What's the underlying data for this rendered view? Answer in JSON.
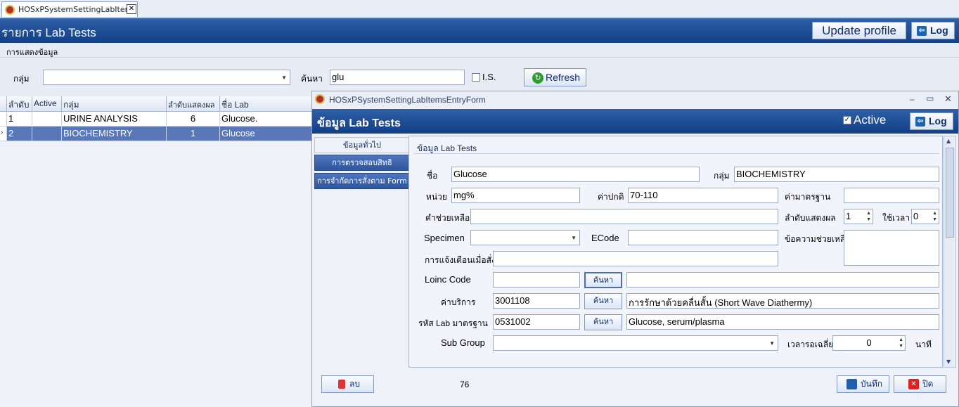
{
  "tab": {
    "title": "HOSxPSystemSettingLabItems",
    "close": "✕"
  },
  "header": {
    "title": "รายการ Lab Tests",
    "update_profile": "Update profile",
    "log": "Log"
  },
  "subbar": {
    "label": "การแสดงข้อมูล"
  },
  "filter": {
    "group_label": "กลุ่ม",
    "group_value": "",
    "search_label": "ค้นหา",
    "search_value": "glu",
    "is_label": "I.S.",
    "is_checked": false,
    "refresh": "Refresh"
  },
  "grid": {
    "columns": [
      "ลำดับ",
      "Active",
      "กลุ่ม",
      "ลำดับแสดงผล",
      "ชื่อ Lab"
    ],
    "rows": [
      [
        "1",
        "",
        "URINE ANALYSIS",
        "6",
        "Glucose."
      ],
      [
        "2",
        "",
        "BIOCHEMISTRY",
        "1",
        "Glucose"
      ]
    ],
    "selected_row": 1
  },
  "dialog": {
    "title": "HOSxPSystemSettingLabItemsEntryForm",
    "win_controls": [
      "–",
      "▭",
      "✕"
    ],
    "header_title": "ข้อมูล Lab Tests",
    "active_label": "Active",
    "active_checked": true,
    "log": "Log",
    "nav": [
      "ข้อมูลทั่วไป",
      "การตรวจสอบสิทธิ",
      "การจำกัดการสั่งตาม Form"
    ],
    "section_title": "ข้อมูล Lab Tests",
    "fields": {
      "name_label": "ชื่อ",
      "name": "Glucose",
      "group_label": "กลุ่ม",
      "group": "BIOCHEMISTRY",
      "unit_label": "หน่วย",
      "unit": "mg%",
      "normal_label": "ค่าปกติ",
      "normal": "70-110",
      "standard_label": "ค่ามาตรฐาน",
      "standard": "",
      "help_label": "คำช่วยเหลือ",
      "help": "",
      "display_order_label": "ลำดับแสดงผล",
      "display_order": "1",
      "time_label": "ใช้เวลา",
      "time": "0",
      "specimen_label": "Specimen",
      "specimen": "",
      "ecode_label": "ECode",
      "ecode": "",
      "help_msg_label": "ข้อความช่วยเหลือ",
      "help_msg": "",
      "alert_label": "การแจ้งเตือนเมื่อสั่ง",
      "alert": "",
      "loinc_label": "Loinc Code",
      "loinc": "",
      "loinc_desc": "",
      "service_label": "ค่าบริการ",
      "service": "3001108",
      "service_desc": "การรักษาด้วยคลื่นสั้น (Short Wave Diathermy)",
      "std_lab_label": "รหัส Lab มาตรฐาน",
      "std_lab": "0531002",
      "std_lab_desc": "Glucose, serum/plasma",
      "subgroup_label": "Sub Group",
      "subgroup": "",
      "avg_wait_label": "เวลารอเฉลี่ย",
      "avg_wait": "0",
      "minute_label": "นาที",
      "search_btn": "ค้นหา"
    },
    "footer": {
      "delete": "ลบ",
      "count": "76",
      "save": "บันทึก",
      "close": "ปิด"
    }
  },
  "colors": {
    "header_blue": "#1d4a92",
    "accent_green": "#2f9b2f",
    "selected_row": "#5a78b8"
  }
}
